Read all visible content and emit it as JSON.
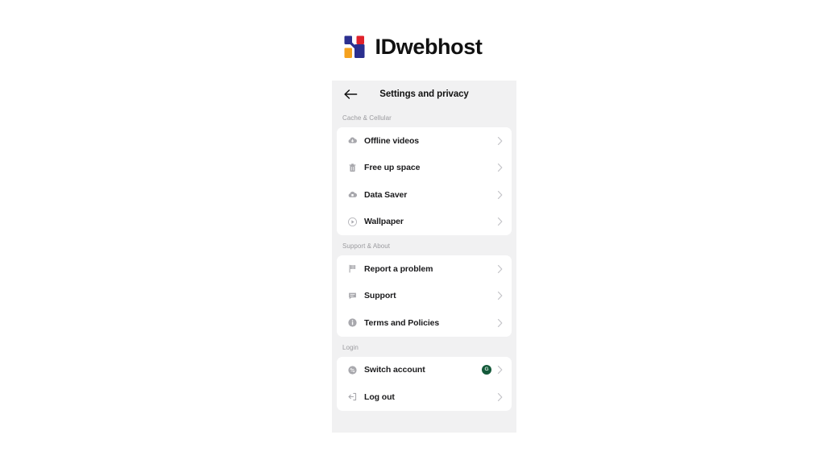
{
  "brand": {
    "name": "IDwebhost",
    "logo_colors": {
      "blue": "#2b2f8f",
      "red": "#e0222b",
      "orange": "#f5a11e"
    }
  },
  "panel": {
    "header": {
      "back_icon": "arrow-left-icon",
      "title": "Settings and privacy"
    },
    "sections": [
      {
        "label": "Cache & Cellular",
        "items": [
          {
            "icon": "cloud-download-icon",
            "label": "Offline videos",
            "chevron": "chevron-right-icon"
          },
          {
            "icon": "trash-icon",
            "label": "Free up space",
            "chevron": "chevron-right-icon"
          },
          {
            "icon": "data-saver-icon",
            "label": "Data Saver",
            "chevron": "chevron-right-icon"
          },
          {
            "icon": "play-circle-icon",
            "label": "Wallpaper",
            "chevron": "chevron-right-icon"
          }
        ]
      },
      {
        "label": "Support & About",
        "items": [
          {
            "icon": "flag-icon",
            "label": "Report a problem",
            "chevron": "chevron-right-icon"
          },
          {
            "icon": "chat-bubble-icon",
            "label": "Support",
            "chevron": "chevron-right-icon"
          },
          {
            "icon": "info-circle-icon",
            "label": "Terms and Policies",
            "chevron": "chevron-right-icon"
          }
        ]
      },
      {
        "label": "Login",
        "items": [
          {
            "icon": "switch-account-icon",
            "label": "Switch account",
            "badge": "G",
            "badge_color": "#14593a",
            "chevron": "chevron-right-icon"
          },
          {
            "icon": "logout-icon",
            "label": "Log out",
            "chevron": "chevron-right-icon"
          }
        ]
      }
    ]
  }
}
